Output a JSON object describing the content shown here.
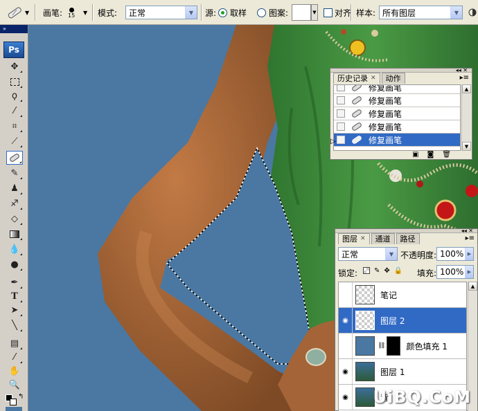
{
  "options_bar": {
    "brush_label": "画笔:",
    "brush_size": "15",
    "mode_label": "模式:",
    "mode_value": "正常",
    "source_label": "源:",
    "source_sample_label": "取样",
    "source_pattern_label": "图案:",
    "aligned_label": "对齐",
    "sample_label": "样本:",
    "sample_value": "所有图层"
  },
  "toolbox": {
    "logo": "Ps"
  },
  "history_panel": {
    "tabs": [
      {
        "label": "历史记录",
        "active": true
      },
      {
        "label": "动作",
        "active": false
      }
    ],
    "items": [
      {
        "label": "修复画笔",
        "selected": false
      },
      {
        "label": "修复画笔",
        "selected": false
      },
      {
        "label": "修复画笔",
        "selected": false
      },
      {
        "label": "修复画笔",
        "selected": false
      },
      {
        "label": "修复画笔",
        "selected": true
      }
    ]
  },
  "layers_panel": {
    "tabs": [
      {
        "label": "图层",
        "active": true
      },
      {
        "label": "通道",
        "active": false
      },
      {
        "label": "路径",
        "active": false
      }
    ],
    "blend_mode": "正常",
    "opacity_label": "不透明度:",
    "opacity_value": "100%",
    "lock_label": "锁定:",
    "fill_label": "填充:",
    "fill_value": "100%",
    "layers": [
      {
        "name": "笔记",
        "visible": false,
        "selected": false
      },
      {
        "name": "图层 2",
        "visible": true,
        "selected": true
      },
      {
        "name": "颜色填充 1",
        "visible": false,
        "selected": false
      },
      {
        "name": "图层 1",
        "visible": true,
        "selected": false
      },
      {
        "name": "背",
        "visible": true,
        "selected": false
      }
    ]
  },
  "watermark": "UiBQ.CoM",
  "colors": {
    "selection_blue": "#316ac5",
    "canvas_background": "#4a78a2",
    "dress_green": "#3f8a3a",
    "skin": "#a9683a"
  }
}
